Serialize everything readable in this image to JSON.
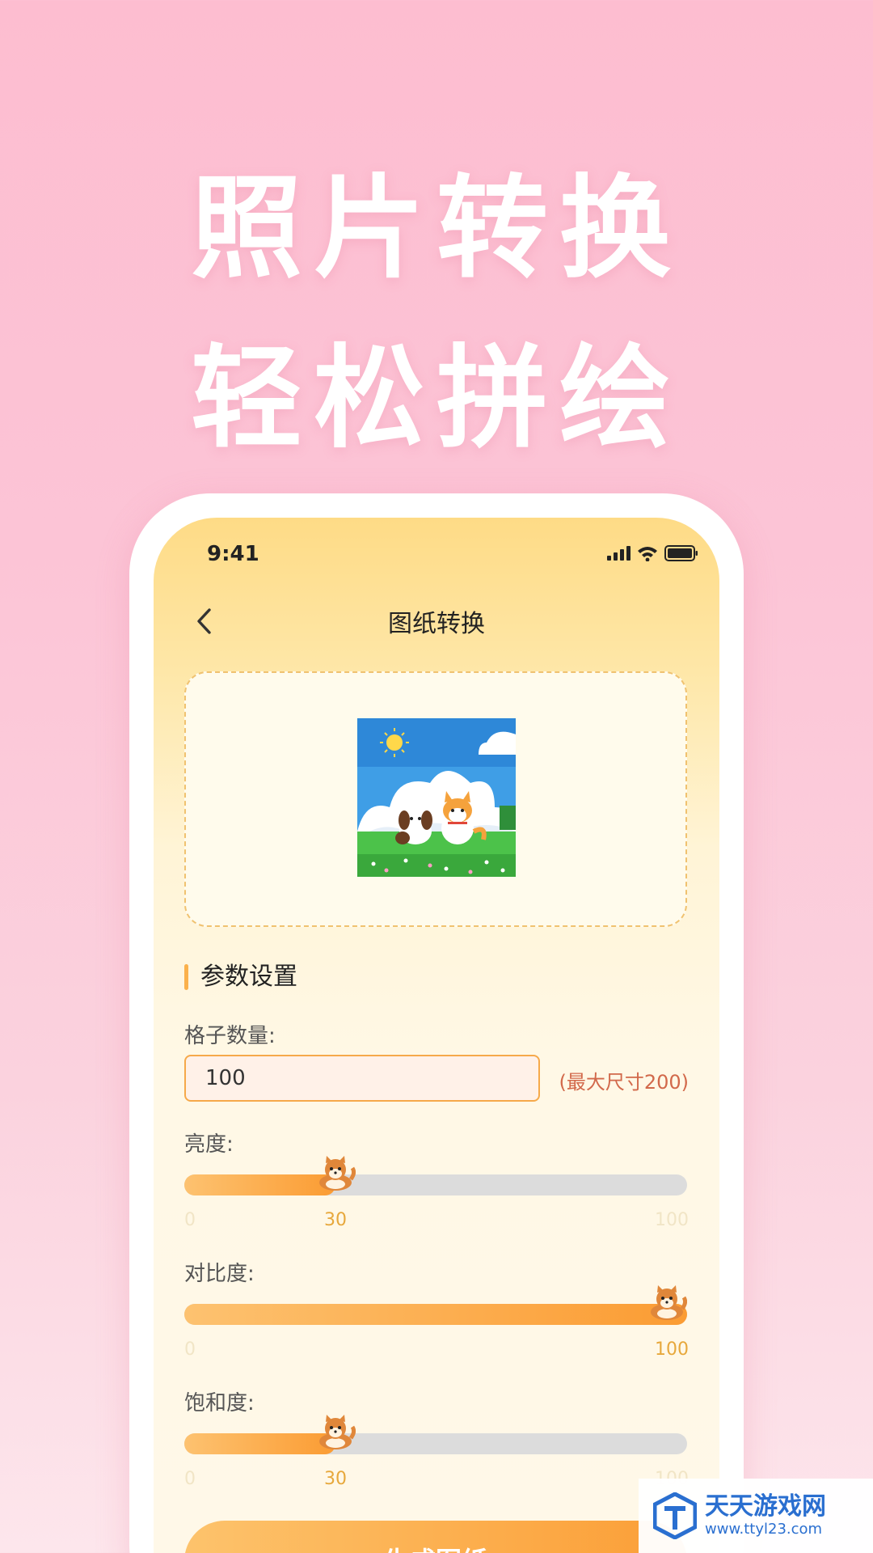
{
  "promo": {
    "line1": "照片转换",
    "line2": "轻松拼绘"
  },
  "status_bar": {
    "time": "9:41",
    "icons": [
      "signal-icon",
      "wifi-icon",
      "battery-icon"
    ]
  },
  "nav": {
    "back_icon": "chevron-left-icon",
    "title": "图纸转换"
  },
  "preview": {
    "description_icon": "pixel-art-dog-cat-image"
  },
  "params": {
    "section_title": "参数设置",
    "grid_count": {
      "label": "格子数量:",
      "value": "100",
      "hint": "(最大尺寸200)"
    },
    "brightness": {
      "label": "亮度:",
      "min": "0",
      "max": "100",
      "value": 30,
      "value_label": "30"
    },
    "contrast": {
      "label": "对比度:",
      "min": "0",
      "max": "100",
      "value": 100,
      "value_label": "100"
    },
    "saturation": {
      "label": "饱和度:",
      "min": "0",
      "max": "100",
      "value": 30,
      "value_label": "30"
    }
  },
  "actions": {
    "generate_label": "生成图纸"
  },
  "watermark": {
    "name": "天天游戏网",
    "url": "www.ttyl23.com"
  },
  "colors": {
    "accent": "#fb9c33",
    "accent_light": "#fdc270",
    "background_pink": "#fdbdd0",
    "hint_red": "#d2694b"
  }
}
